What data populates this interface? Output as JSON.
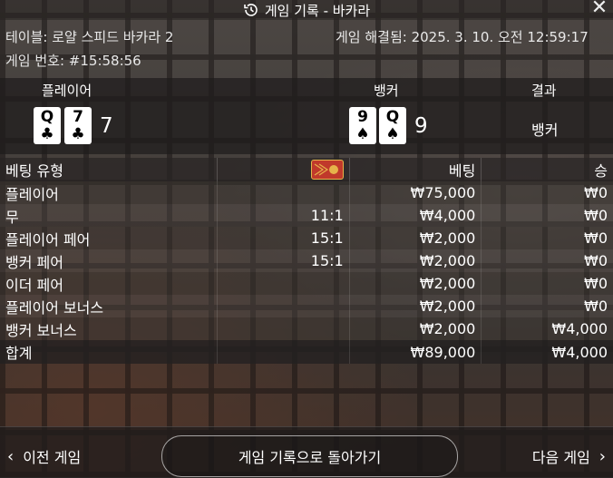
{
  "header": {
    "title": "게임 기록 - 바카라",
    "close_symbol": "✕"
  },
  "info": {
    "table_name": "테이블: 로얄 스피드 바카라 2",
    "resolved": "게임 해결됨: 2025. 3. 10. 오전 12:59:17",
    "game_number": "게임 번호: #15:58:56"
  },
  "result": {
    "player_label": "플레이어",
    "banker_label": "뱅커",
    "outcome_label": "결과",
    "player_cards": [
      {
        "rank": "Q",
        "suit": "♣"
      },
      {
        "rank": "7",
        "suit": "♣"
      }
    ],
    "player_score": "7",
    "banker_cards": [
      {
        "rank": "9",
        "suit": "♠"
      },
      {
        "rank": "Q",
        "suit": "♠"
      }
    ],
    "banker_score": "9",
    "outcome": "뱅커"
  },
  "bets": {
    "headers": [
      "베팅 유형",
      "",
      "베팅",
      "승"
    ],
    "rows": [
      {
        "type": "플레이어",
        "odds": "",
        "bet": "₩75,000",
        "win": "₩0"
      },
      {
        "type": "무",
        "odds": "11:1",
        "bet": "₩4,000",
        "win": "₩0"
      },
      {
        "type": "플레이어 페어",
        "odds": "15:1",
        "bet": "₩2,000",
        "win": "₩0"
      },
      {
        "type": "뱅커 페어",
        "odds": "15:1",
        "bet": "₩2,000",
        "win": "₩0"
      },
      {
        "type": "이더 페어",
        "odds": "",
        "bet": "₩2,000",
        "win": "₩0"
      },
      {
        "type": "플레이어 보너스",
        "odds": "",
        "bet": "₩2,000",
        "win": "₩0"
      },
      {
        "type": "뱅커 보너스",
        "odds": "",
        "bet": "₩2,000",
        "win": "₩4,000"
      }
    ],
    "total": {
      "label": "합계",
      "bet": "₩89,000",
      "win": "₩4,000"
    }
  },
  "footer": {
    "prev": "이전 게임",
    "back": "게임 기록으로 돌아가기",
    "next": "다음 게임"
  },
  "colors": {
    "chip": "#c0392b",
    "chip_border": "#e6b34a"
  }
}
